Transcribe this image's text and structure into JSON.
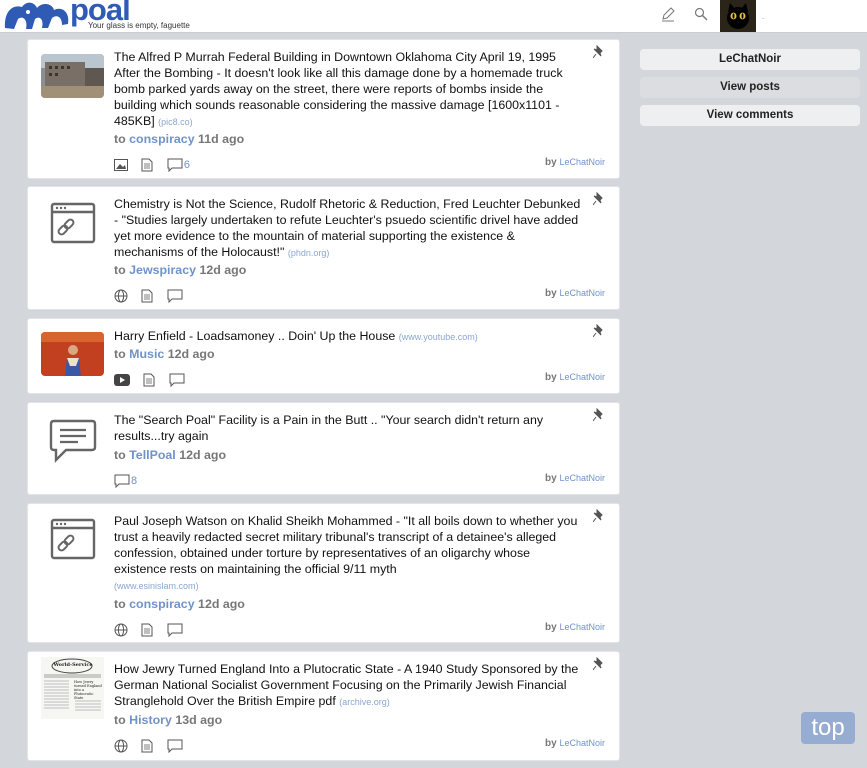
{
  "site": {
    "name": "poal",
    "tagline": "Your glass is empty, faguette"
  },
  "header": {
    "avatar_marker": "."
  },
  "posts": [
    {
      "title": "The Alfred P Murrah Federal Building in Downtown Oklahoma City April 19, 1995 After the Bombing - It doesn't look like all this damage done by a homemade truck bomb parked yards away on the street, there were reports of bombs inside the building which sounds reasonable considering the massive damage [1600x1101 - 485KB]",
      "domain": "(pic8.co)",
      "to": "to",
      "community": "conspiracy",
      "age": "11d ago",
      "comments": "6",
      "by": "by",
      "user": "LeChatNoir",
      "type": "image"
    },
    {
      "title": "Chemistry is Not the Science, Rudolf Rhetoric & Reduction, Fred Leuchter Debunked - \"Studies largely undertaken to refute Leuchter's psuedo scientific drivel have added yet more evidence to the mountain of material supporting the existence & mechanisms of the Holocaust!\"",
      "domain": "(phdn.org)",
      "to": "to",
      "community": "Jewspiracy",
      "age": "12d ago",
      "comments": "",
      "by": "by",
      "user": "LeChatNoir",
      "type": "link"
    },
    {
      "title": "Harry Enfield - Loadsamoney .. Doin' Up the House",
      "domain": "(www.youtube.com)",
      "to": "to",
      "community": "Music",
      "age": "12d ago",
      "comments": "",
      "by": "by",
      "user": "LeChatNoir",
      "type": "video"
    },
    {
      "title": "The \"Search Poal\" Facility is a Pain in the Butt .. \"Your search didn't return any results...try again",
      "domain": "",
      "to": "to",
      "community": "TellPoal",
      "age": "12d ago",
      "comments": "8",
      "by": "by",
      "user": "LeChatNoir",
      "type": "text"
    },
    {
      "title": "Paul Joseph Watson on Khalid Sheikh Mohammed - \"It all boils down to whether you trust a heavily redacted secret military tribunal's transcript of a detainee's alleged confession, obtained under torture by representatives of an oligarchy whose existence rests on maintaining the official 9/11 myth",
      "domain": "(www.esinislam.com)",
      "to": "to",
      "community": "conspiracy",
      "age": "12d ago",
      "comments": "",
      "by": "by",
      "user": "LeChatNoir",
      "type": "link"
    },
    {
      "title": "How Jewry Turned England Into a Plutocratic State - A 1940 Study Sponsored by the German National Socialist Government Focusing on the Primarily Jewish Financial Stranglehold Over the British Empire pdf",
      "domain": "(archive.org)",
      "to": "to",
      "community": "History",
      "age": "13d ago",
      "comments": "",
      "by": "by",
      "user": "LeChatNoir",
      "type": "document",
      "thumb_text": {
        "masthead": "World-Service",
        "headline": "How Jewry turned England into a Plutocratic State"
      }
    }
  ],
  "sidebar": {
    "username": "LeChatNoir",
    "view_posts": "View posts",
    "view_comments": "View comments"
  },
  "top_button": "top",
  "colors": {
    "accent": "#6f93c9",
    "brand": "#2f5bb5",
    "background": "#d3d6db"
  }
}
